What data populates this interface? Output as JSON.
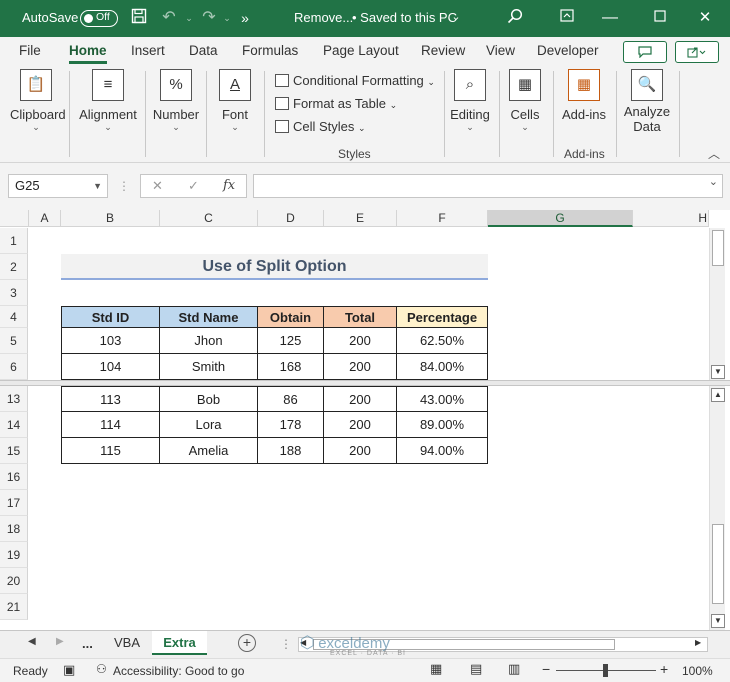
{
  "titlebar": {
    "autosave_label": "AutoSave",
    "toggle_state": "Off",
    "file_name": "Remove...",
    "save_status": "• Saved to this PC",
    "chevron": "⌄"
  },
  "menu": {
    "tabs": [
      "File",
      "Home",
      "Insert",
      "Data",
      "Formulas",
      "Page Layout",
      "Review",
      "View",
      "Developer"
    ],
    "active": "Home"
  },
  "ribbon": {
    "clipboard": "Clipboard",
    "alignment": "Alignment",
    "number": "Number",
    "font": "Font",
    "conditional_formatting": "Conditional Formatting",
    "format_as_table": "Format as Table",
    "cell_styles": "Cell Styles",
    "styles_group": "Styles",
    "editing": "Editing",
    "cells": "Cells",
    "addins": "Add-ins",
    "addins_group": "Add-ins",
    "analyze_data_1": "Analyze",
    "analyze_data_2": "Data"
  },
  "formula_bar": {
    "name_box": "G25",
    "cancel": "✕",
    "enter": "✓",
    "fx": "fx",
    "value": ""
  },
  "columns": [
    "A",
    "B",
    "C",
    "D",
    "E",
    "F",
    "G",
    "H"
  ],
  "selected_column": "G",
  "rows_top": [
    "1",
    "2",
    "3",
    "4",
    "5",
    "6"
  ],
  "rows_bottom": [
    "13",
    "14",
    "15",
    "16",
    "17",
    "18",
    "19",
    "20",
    "21"
  ],
  "sheet": {
    "title": "Use of Split Option",
    "headers": [
      "Std ID",
      "Std Name",
      "Obtain",
      "Total",
      "Percentage"
    ],
    "header_colors": [
      "#bdd7ee",
      "#bdd7ee",
      "#f8cbad",
      "#f8cbad",
      "#fff2cc"
    ],
    "rows_top": [
      [
        "103",
        "Jhon",
        "125",
        "200",
        "62.50%"
      ],
      [
        "104",
        "Smith",
        "168",
        "200",
        "84.00%"
      ]
    ],
    "rows_bottom": [
      [
        "113",
        "Bob",
        "86",
        "200",
        "43.00%"
      ],
      [
        "114",
        "Lora",
        "178",
        "200",
        "89.00%"
      ],
      [
        "115",
        "Amelia",
        "188",
        "200",
        "94.00%"
      ]
    ]
  },
  "sheet_tabs": {
    "ellipsis": "...",
    "tabs": [
      "VBA",
      "Extra"
    ],
    "active": "Extra"
  },
  "watermark": {
    "name": "exceldemy",
    "tagline": "EXCEL · DATA · BI"
  },
  "status": {
    "ready": "Ready",
    "accessibility": "Accessibility: Good to go",
    "zoom": "100%",
    "minus": "−",
    "plus": "+"
  },
  "accent_color": "#217346"
}
